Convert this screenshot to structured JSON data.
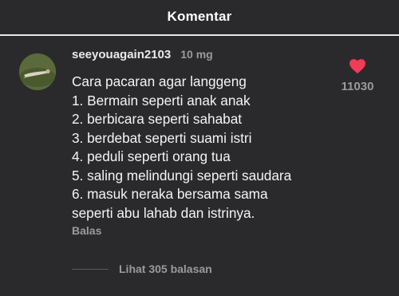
{
  "header": {
    "title": "Komentar"
  },
  "comment": {
    "avatar_icon": "user-avatar-photo",
    "username": "seeyouagain2103",
    "time": "10 mg",
    "lines": [
      "Cara pacaran agar langgeng",
      "1. Bermain seperti anak anak",
      "2. berbicara seperti sahabat",
      "3. berdebat seperti suami istri",
      "4. peduli seperti orang tua",
      "5. saling melindungi seperti saudara",
      "6. masuk neraka bersama sama",
      "seperti abu lahab dan istrinya."
    ],
    "reply_label": "Balas",
    "like_icon": "heart-icon",
    "like_color": "#f23b55",
    "like_count": "11030",
    "more_replies_label": "Lihat 305 balasan"
  }
}
